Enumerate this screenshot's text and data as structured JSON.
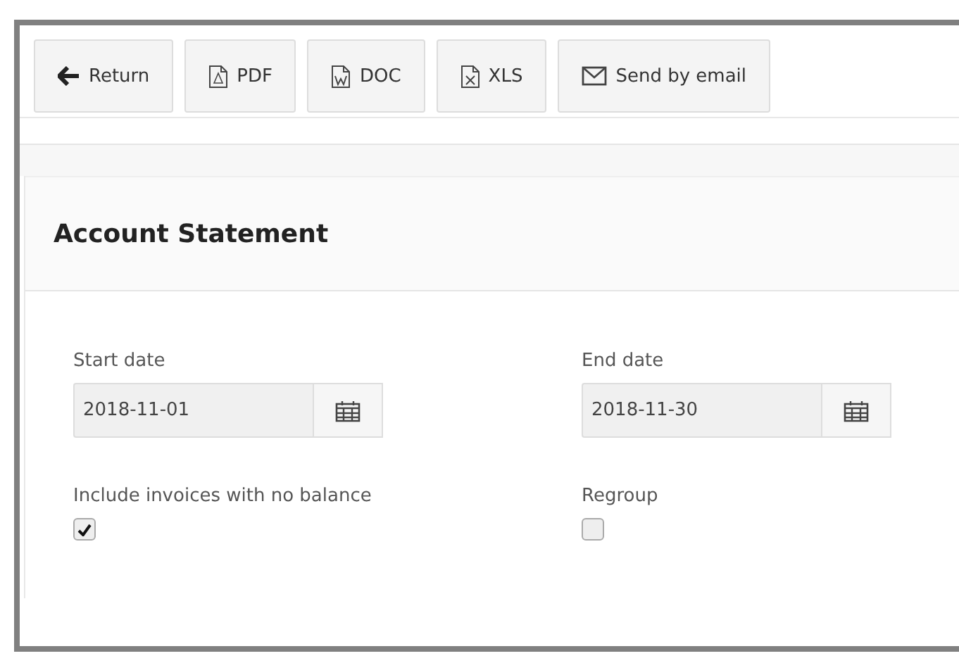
{
  "toolbar": {
    "buttons": [
      {
        "kind": "return",
        "label": "Return"
      },
      {
        "kind": "pdf",
        "label": "PDF"
      },
      {
        "kind": "doc",
        "label": "DOC"
      },
      {
        "kind": "xls",
        "label": "XLS"
      },
      {
        "kind": "email",
        "label": "Send by email"
      }
    ]
  },
  "panel": {
    "title": "Account Statement",
    "dates": [
      {
        "label": "Start date",
        "value": "2018-11-01"
      },
      {
        "label": "End date",
        "value": "2018-11-30"
      }
    ],
    "options": [
      {
        "label": "Include invoices with no balance",
        "checked": true
      },
      {
        "label": "Regroup",
        "checked": false
      }
    ]
  }
}
